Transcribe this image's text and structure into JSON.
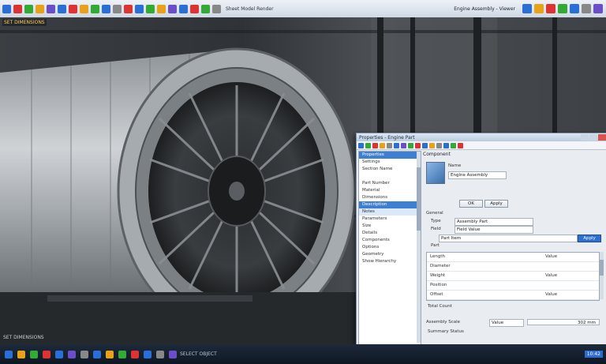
{
  "toolbar": {
    "icons": [
      "#2a6fd6",
      "#d33",
      "#3a3",
      "#e8a21a",
      "#6a4fc9",
      "#2a6fd6",
      "#d33",
      "#e8a21a",
      "#3a3",
      "#2a6fd6",
      "#888",
      "#d33",
      "#2a6fd6",
      "#3a3",
      "#e8a21a",
      "#6a4fc9",
      "#2a6fd6",
      "#d33",
      "#3a3",
      "#888"
    ],
    "text_left": "Sheet Model Render",
    "title": "Engine Assembly - Viewer",
    "right_icons": [
      "#2a6fd6",
      "#e8a21a",
      "#d33",
      "#3a3",
      "#2a6fd6",
      "#888",
      "#6a4fc9"
    ]
  },
  "viewport": {
    "label": "SET DIMENSIONS",
    "status": "SET DIMENSIONS"
  },
  "dialog": {
    "title": "Properties - Engine Part",
    "tool_colors": [
      "#2a6fd6",
      "#3a3",
      "#d33",
      "#e8a21a",
      "#888",
      "#2a6fd6",
      "#6a4fc9",
      "#3a3",
      "#d33",
      "#2a6fd6",
      "#e8a21a",
      "#888",
      "#2a6fd6",
      "#3a3",
      "#d33"
    ],
    "tree": [
      {
        "label": "Properties",
        "state": "sel"
      },
      {
        "label": "Settings",
        "state": ""
      },
      {
        "label": "Section Name",
        "state": ""
      },
      {
        "label": "",
        "state": ""
      },
      {
        "label": "Part Number",
        "state": ""
      },
      {
        "label": "Material",
        "state": ""
      },
      {
        "label": "Dimensions",
        "state": ""
      },
      {
        "label": "Description",
        "state": "sel"
      },
      {
        "label": "Notes",
        "state": "hl"
      },
      {
        "label": "Parameters",
        "state": ""
      },
      {
        "label": "Size",
        "state": ""
      },
      {
        "label": "Details",
        "state": ""
      },
      {
        "label": "Components",
        "state": ""
      },
      {
        "label": "Options",
        "state": ""
      },
      {
        "label": "Geometry",
        "state": ""
      },
      {
        "label": "Show Hierarchy",
        "state": ""
      }
    ],
    "props": {
      "header": "Component",
      "name_label": "Name",
      "name_value": "Engine Assembly",
      "btn_a": "OK",
      "btn_b": "Apply",
      "section": "General",
      "type_label": "Type",
      "type_value": "Assembly Part",
      "field_label": "Field",
      "field_value": "Field Value",
      "part_label": "Part",
      "part_value": "Part Item",
      "apply_btn": "Apply",
      "rows": [
        {
          "label": "Length",
          "value": "Value"
        },
        {
          "label": "Diameter",
          "value": ""
        },
        {
          "label": "Weight",
          "value": "Value"
        },
        {
          "label": "Position",
          "value": ""
        },
        {
          "label": "Offset",
          "value": "Value"
        }
      ],
      "footer_label": "Total Count",
      "status_label": "Assembly Scale",
      "status_value": "Value",
      "result_value": "302 mm",
      "status_line": "Summary Status",
      "ok_btn": "OK"
    }
  },
  "taskbar": {
    "icons": [
      "#2a6fd6",
      "#e8a21a",
      "#3a3",
      "#d33",
      "#2a6fd6",
      "#6a4fc9",
      "#888",
      "#2a6fd6",
      "#e8a21a",
      "#3a3",
      "#d33",
      "#2a6fd6",
      "#888",
      "#6a4fc9"
    ],
    "text": "SELECT OBJECT",
    "clock": "10:42"
  }
}
